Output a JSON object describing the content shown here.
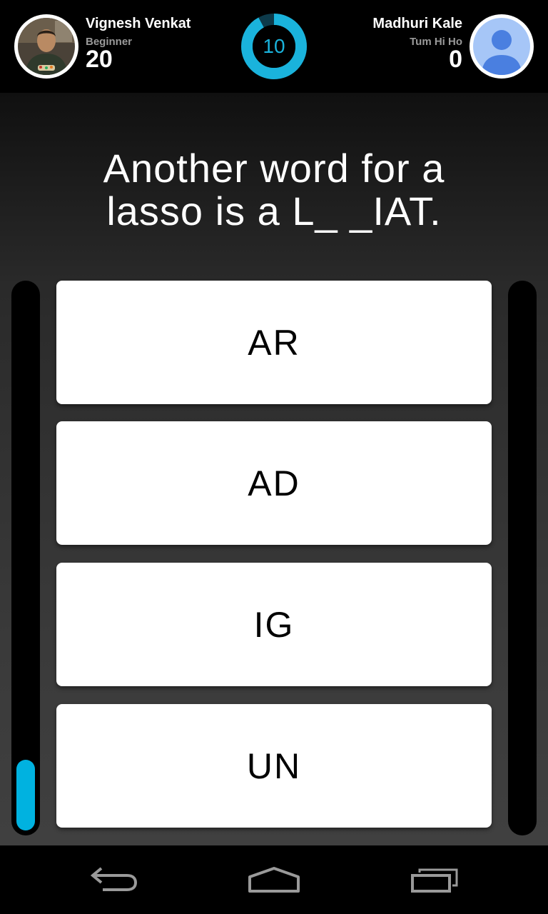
{
  "player_left": {
    "name": "Vignesh Venkat",
    "level": "Beginner",
    "score": "20",
    "avatar_icon": "user-photo-icon"
  },
  "player_right": {
    "name": "Madhuri Kale",
    "level": "Tum Hi Ho",
    "score": "0",
    "avatar_icon": "default-person-icon"
  },
  "timer": {
    "value": "10",
    "remaining_fraction": 0.92,
    "color": "#1ab3dc"
  },
  "question": {
    "line1": "Another word for a",
    "line2": "lasso is a L_ _IAT."
  },
  "answers": [
    {
      "label": "AR"
    },
    {
      "label": "AD"
    },
    {
      "label": "IG"
    },
    {
      "label": "UN"
    }
  ],
  "progress": {
    "left_fraction": 0.13,
    "right_fraction": 0,
    "color": "#00b2e0"
  },
  "navbar": {
    "back_icon": "back-arrow-icon",
    "home_icon": "home-icon",
    "recents_icon": "recent-apps-icon"
  }
}
